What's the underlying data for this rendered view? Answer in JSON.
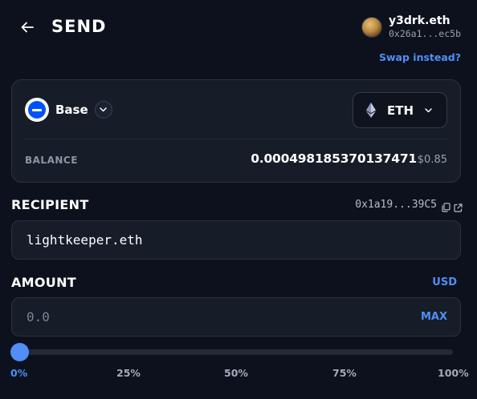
{
  "header": {
    "title": "SEND",
    "account_name": "y3drk.eth",
    "account_address": "0x26a1...ec5b",
    "swap_link": "Swap instead?"
  },
  "source": {
    "chain": "Base",
    "token": "ETH",
    "balance_label": "BALANCE",
    "balance_value": "0.000498185370137471",
    "balance_usd": "$0.85"
  },
  "recipient": {
    "label": "RECIPIENT",
    "address": "0x1a19...39C5",
    "value": "lightkeeper.eth"
  },
  "amount": {
    "label": "AMOUNT",
    "currency_toggle": "USD",
    "placeholder": "0.0",
    "max_label": "MAX",
    "slider_percent": 0,
    "slider_labels": [
      "0%",
      "25%",
      "50%",
      "75%",
      "100%"
    ]
  },
  "icons": [
    "back-arrow-icon",
    "chevron-down-icon",
    "ethereum-icon",
    "copy-icon",
    "external-link-icon"
  ],
  "colors": {
    "background": "#0c111d",
    "card": "#161c28",
    "accent": "#4f8ff7",
    "base_blue": "#0052ff"
  }
}
